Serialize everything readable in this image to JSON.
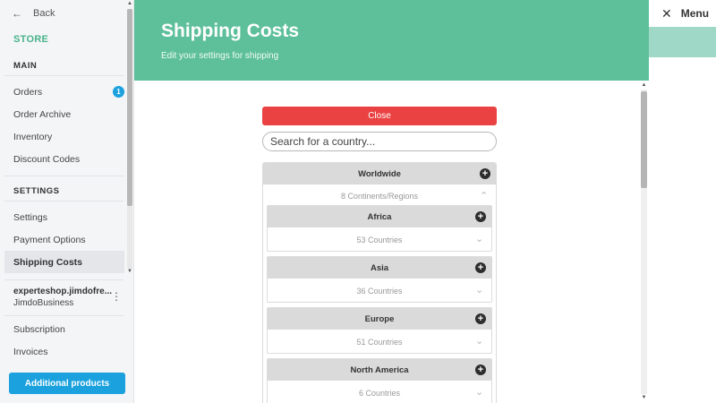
{
  "sidebar": {
    "back_label": "Back",
    "store_label": "STORE",
    "sections": {
      "main": "MAIN",
      "settings": "SETTINGS"
    },
    "main_items": [
      {
        "label": "Orders",
        "badge": "1"
      },
      {
        "label": "Order Archive"
      },
      {
        "label": "Inventory"
      },
      {
        "label": "Discount Codes"
      }
    ],
    "settings_items": [
      {
        "label": "Settings"
      },
      {
        "label": "Payment Options"
      },
      {
        "label": "Shipping Costs",
        "active": true
      }
    ],
    "account": {
      "domain": "experteshop.jimdofre...",
      "plan": "JimdoBusiness"
    },
    "bottom_items": [
      {
        "label": "Subscription"
      },
      {
        "label": "Invoices"
      }
    ],
    "cta_label": "Additional products"
  },
  "header": {
    "title": "Shipping Costs",
    "subtitle": "Edit your settings for shipping"
  },
  "right_panel": {
    "menu_label": "Menu"
  },
  "shipping": {
    "close_label": "Close",
    "search_placeholder": "Search for a country...",
    "worldwide": {
      "label": "Worldwide",
      "sub_label": "8 Continents/Regions"
    },
    "regions": [
      {
        "name": "Africa",
        "count": "53 Countries"
      },
      {
        "name": "Asia",
        "count": "36 Countries"
      },
      {
        "name": "Europe",
        "count": "51 Countries"
      },
      {
        "name": "North America",
        "count": "6 Countries"
      }
    ]
  },
  "colors": {
    "header": "#5ec09a",
    "accent_green": "#49b48a",
    "close_button": "#ea4242",
    "cta_button": "#1aa1de",
    "badge": "#1aa1de"
  },
  "icons": {
    "back": "arrow-left-icon",
    "close_menu": "close-icon",
    "add": "plus-circle-icon",
    "expand": "chevron-down-icon",
    "collapse": "chevron-up-icon",
    "more": "kebab-icon"
  }
}
